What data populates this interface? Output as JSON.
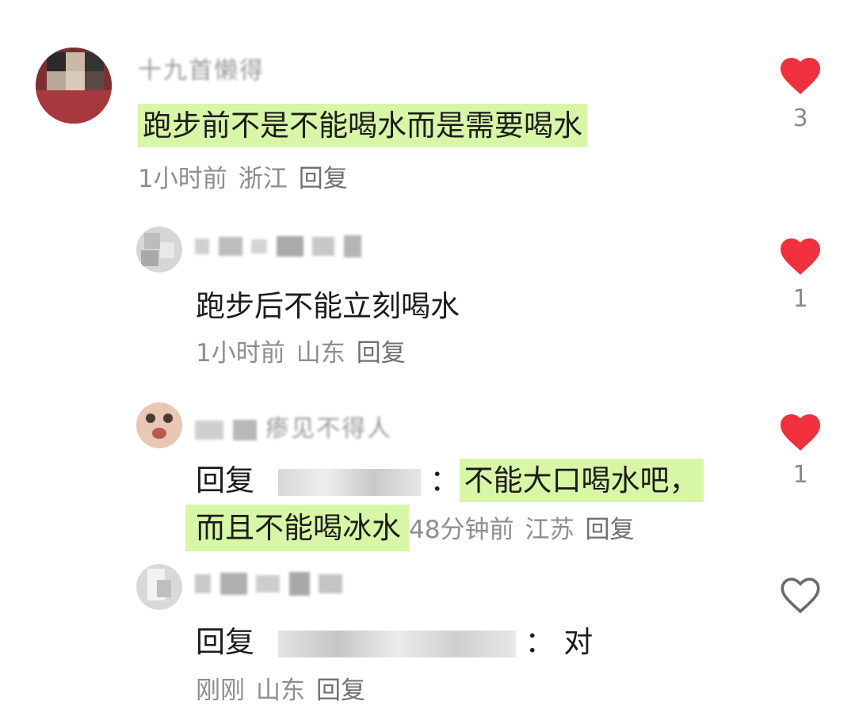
{
  "comments": [
    {
      "author_visible": "十九首懒得",
      "text": "跑步前不是不能喝水而是需要喝水",
      "time": "1小时前",
      "location": "浙江",
      "reply_label": "回复",
      "likes": "3",
      "liked": true
    },
    {
      "text": "跑步后不能立刻喝水",
      "time": "1小时前",
      "location": "山东",
      "reply_label": "回复",
      "likes": "1",
      "liked": true
    },
    {
      "author_visible": "瘆见不得人",
      "reply_prefix": "回复",
      "text_line1": "不能大口喝水吧，",
      "text_line2": "而且不能喝冰水",
      "time": "48分钟前",
      "location": "江苏",
      "reply_label": "回复",
      "likes": "1",
      "liked": true
    },
    {
      "reply_prefix": "回复",
      "text": "：  对",
      "time": "刚刚",
      "location": "山东",
      "reply_label": "回复",
      "liked": false
    }
  ],
  "colors": {
    "highlight": "#d8f7a6",
    "like_red": "#f0303c",
    "meta_gray": "#8e8e8e"
  },
  "icons": {
    "liked": "heart-filled-icon",
    "unliked": "heart-outline-icon"
  }
}
